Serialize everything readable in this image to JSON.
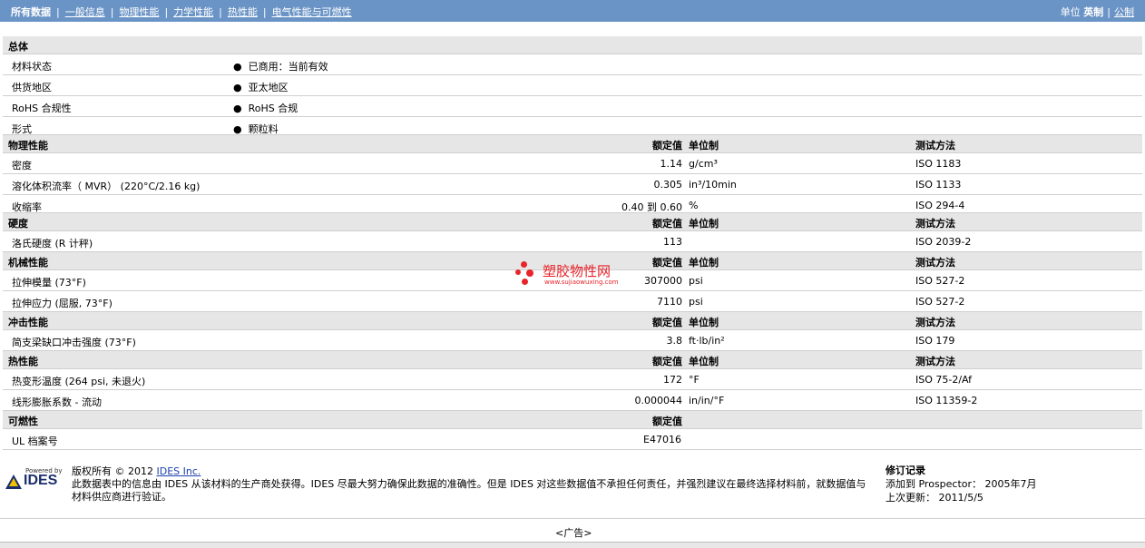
{
  "nav": {
    "items": [
      {
        "label": "所有数据",
        "active": true
      },
      {
        "label": "一般信息"
      },
      {
        "label": "物理性能"
      },
      {
        "label": "力学性能"
      },
      {
        "label": "热性能"
      },
      {
        "label": "电气性能与可燃性"
      }
    ]
  },
  "units": {
    "label": "单位",
    "english": "英制",
    "metric": "公制"
  },
  "sections": {
    "general": {
      "title": "总体",
      "rows": [
        {
          "name": "材料状态",
          "value": "已商用：当前有效"
        },
        {
          "name": "供货地区",
          "value": "亚太地区"
        },
        {
          "name": "RoHS 合规性",
          "value": "RoHS 合规"
        },
        {
          "name": "形式",
          "value": "颗粒料"
        }
      ]
    },
    "physical": {
      "title": "物理性能",
      "h_val": "额定值",
      "h_unit": "单位制",
      "h_test": "测试方法",
      "rows": [
        {
          "name": "密度",
          "value": "1.14",
          "unit": "g/cm³",
          "test": "ISO 1183"
        },
        {
          "name": "溶化体积流率（ MVR） (220°C/2.16 kg)",
          "value": "0.305",
          "unit": "in³/10min",
          "test": "ISO 1133"
        },
        {
          "name": "收缩率",
          "value": "0.40 到  0.60",
          "unit": "%",
          "test": "ISO 294-4"
        }
      ]
    },
    "hardness": {
      "title": "硬度",
      "h_val": "额定值",
      "h_unit": "单位制",
      "h_test": "测试方法",
      "rows": [
        {
          "name": "洛氏硬度 (R 计秤)",
          "value": "113",
          "unit": "",
          "test": "ISO 2039-2"
        }
      ]
    },
    "mechanical": {
      "title": "机械性能",
      "h_val": "额定值",
      "h_unit": "单位制",
      "h_test": "测试方法",
      "rows": [
        {
          "name": "拉伸模量 (73°F)",
          "value": "307000",
          "unit": "psi",
          "test": "ISO 527-2"
        },
        {
          "name": "拉伸应力 (屈服, 73°F)",
          "value": "7110",
          "unit": "psi",
          "test": "ISO 527-2"
        }
      ]
    },
    "impact": {
      "title": "冲击性能",
      "h_val": "额定值",
      "h_unit": "单位制",
      "h_test": "测试方法",
      "rows": [
        {
          "name": "简支梁缺口冲击强度 (73°F)",
          "value": "3.8",
          "unit": "ft·lb/in²",
          "test": "ISO 179"
        }
      ]
    },
    "thermal": {
      "title": "热性能",
      "h_val": "额定值",
      "h_unit": "单位制",
      "h_test": "测试方法",
      "rows": [
        {
          "name": "热变形温度 (264 psi, 未退火)",
          "value": "172",
          "unit": "°F",
          "test": "ISO 75-2/Af"
        },
        {
          "name": "线形膨胀系数  - 流动",
          "value": "0.000044",
          "unit": "in/in/°F",
          "test": "ISO 11359-2"
        }
      ]
    },
    "flammability": {
      "title": "可燃性",
      "h_val": "额定值",
      "rows": [
        {
          "name": "UL 档案号",
          "value": "E47016"
        }
      ]
    }
  },
  "watermark": {
    "cn": "塑胶物性网",
    "url": "www.sujiaowuxing.com"
  },
  "footer": {
    "logo_text": "IDES",
    "powered": "Powered by",
    "copyright_prefix": "版权所有  © 2012 ",
    "company": "IDES Inc.",
    "disclaimer": "此数据表中的信息由 IDES 从该材料的生产商处获得。IDES 尽最大努力确保此数据的准确性。但是 IDES 对这些数据值不承担任何责任，并强烈建议在最终选择材料前，就数据值与材料供应商进行验证。",
    "rev_title": "修订记录",
    "added": "添加到  Prospector： 2005年7月",
    "updated": "上次更新： 2011/5/5"
  },
  "ad": "<广告>"
}
